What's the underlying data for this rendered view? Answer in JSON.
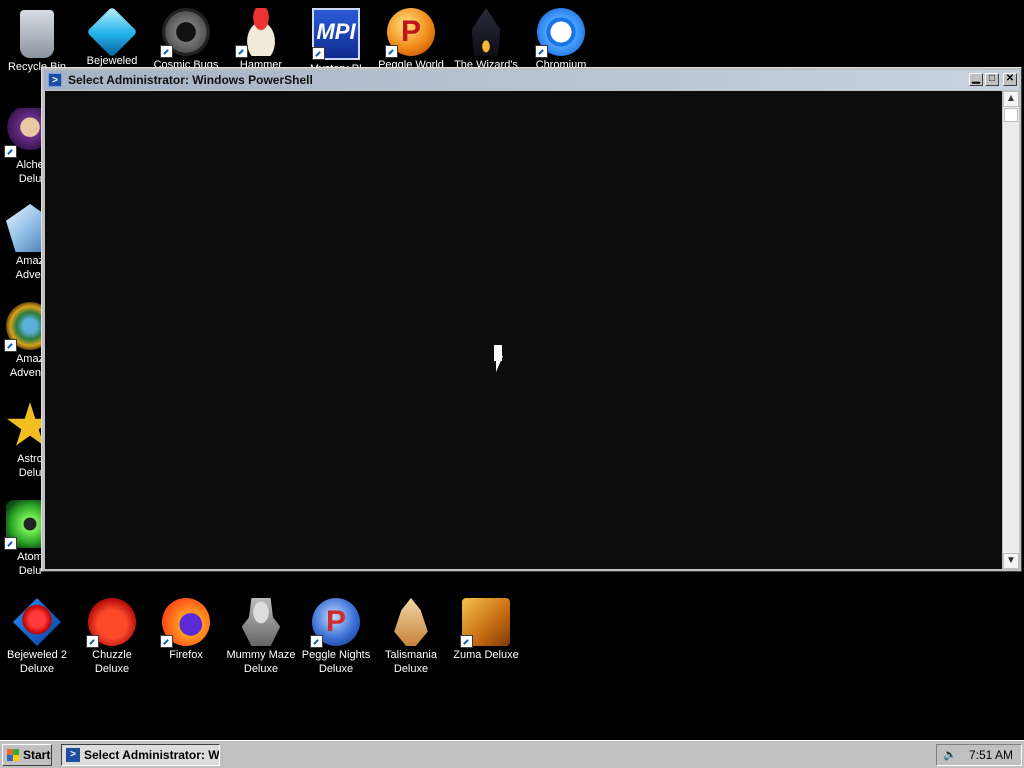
{
  "desktop": {
    "top_icons": [
      {
        "label": "Recycle Bin",
        "icon": "recycle-bin-icon"
      },
      {
        "label": "Bejeweled",
        "icon": "bejeweled-gem-icon"
      },
      {
        "label": "Cosmic Bugs",
        "icon": "cosmic-bugs-gear-icon"
      },
      {
        "label": "Hammer",
        "icon": "hammer-gnome-icon"
      },
      {
        "label": "Mystery PI",
        "icon": "mystery-pi-icon"
      },
      {
        "label": "Peggle World",
        "icon": "peggle-world-icon"
      },
      {
        "label": "The Wizard's",
        "icon": "wizard-tower-icon"
      },
      {
        "label": "Chromium",
        "icon": "chromium-icon"
      }
    ],
    "left_icons": [
      {
        "label": "Alche\nDelu",
        "icon": "alchemy-icon"
      },
      {
        "label": "Amaz\nAdver",
        "icon": "amazing-adventures-icon"
      },
      {
        "label": "Amaz\nAdventu",
        "icon": "amazing-adventures-2-icon"
      },
      {
        "label": "Astro\nDelu",
        "icon": "astro-star-icon"
      },
      {
        "label": "Atom\nDelu",
        "icon": "atomaniac-icon"
      }
    ],
    "bottom_icons": [
      {
        "label": "Bejeweled 2\nDeluxe",
        "icon": "bejeweled-2-icon"
      },
      {
        "label": "Chuzzle\nDeluxe",
        "icon": "chuzzle-icon"
      },
      {
        "label": "Firefox",
        "icon": "firefox-icon"
      },
      {
        "label": "Mummy Maze\nDeluxe",
        "icon": "mummy-maze-icon"
      },
      {
        "label": "Peggle Nights\nDeluxe",
        "icon": "peggle-nights-icon"
      },
      {
        "label": "Talismania\nDeluxe",
        "icon": "talismania-icon"
      },
      {
        "label": "Zuma Deluxe",
        "icon": "zuma-icon"
      }
    ]
  },
  "window": {
    "title": "Select Administrator: Windows PowerShell",
    "buttons": {
      "minimize": "▁",
      "maximize": "□",
      "close": "✕"
    },
    "scroll_up": "▲",
    "scroll_down": "▼",
    "console_text": ""
  },
  "taskbar": {
    "start_label": "Start",
    "task_label": "Select Administrator: W...",
    "clock": "7:51 AM",
    "tray_icon": "speaker-icon"
  }
}
